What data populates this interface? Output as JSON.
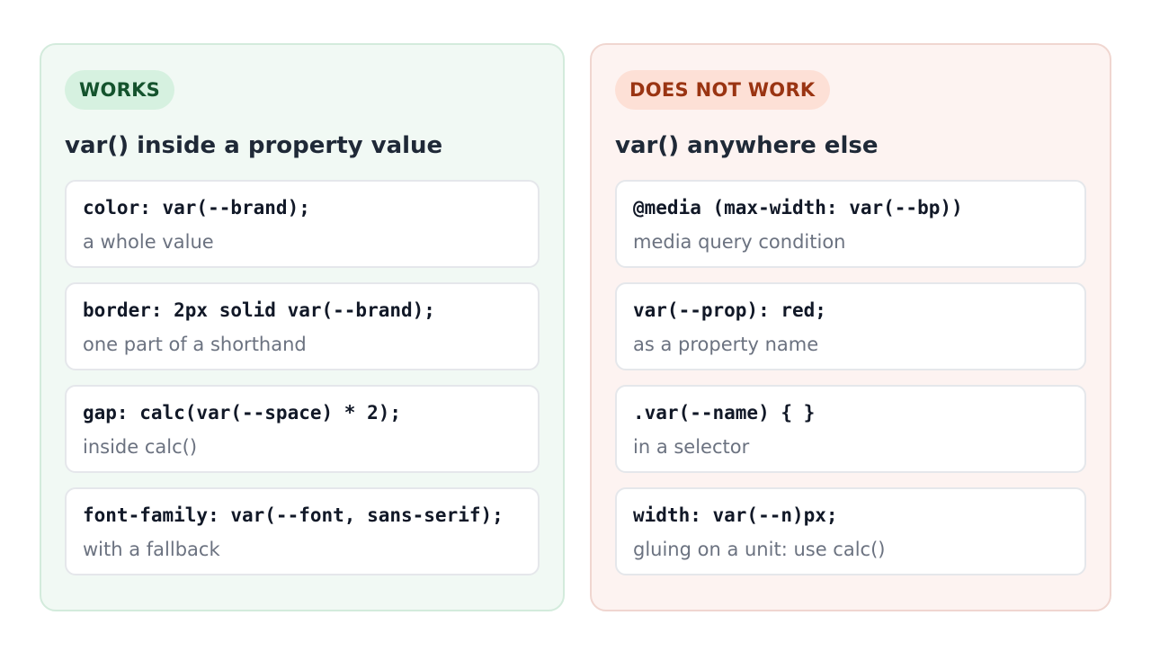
{
  "works": {
    "badge": "WORKS",
    "title": "var() inside a property value",
    "cards": [
      {
        "code": "color: var(--brand);",
        "desc": "a whole value"
      },
      {
        "code": "border: 2px solid var(--brand);",
        "desc": "one part of a shorthand"
      },
      {
        "code": "gap: calc(var(--space) * 2);",
        "desc": "inside calc()"
      },
      {
        "code": "font-family: var(--font, sans-serif);",
        "desc": "with a fallback"
      }
    ]
  },
  "fails": {
    "badge": "DOES NOT WORK",
    "title": "var() anywhere else",
    "cards": [
      {
        "code": "@media (max-width: var(--bp))",
        "desc": "media query condition"
      },
      {
        "code": "var(--prop): red;",
        "desc": "as a property name"
      },
      {
        "code": ".var(--name) { }",
        "desc": "in a selector"
      },
      {
        "code": "width: var(--n)px;",
        "desc": "gluing on a unit: use calc()"
      }
    ]
  },
  "colors": {
    "works_bg": "#f1f9f4",
    "works_badge_text": "#14532d",
    "fails_bg": "#fdf3f1",
    "fails_badge_text": "#9a3412"
  }
}
